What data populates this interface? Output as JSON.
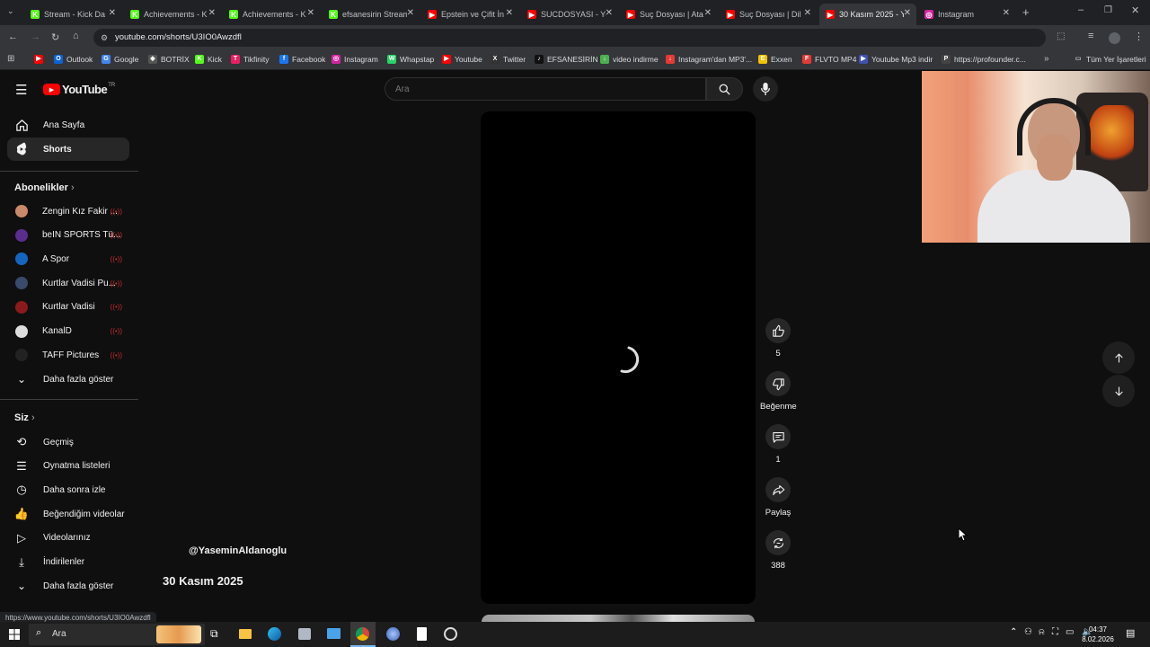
{
  "browser": {
    "tabs": [
      {
        "title": "Stream - Kick Da",
        "favicon": "K",
        "color": "#53fc18"
      },
      {
        "title": "Achievements - K",
        "favicon": "K",
        "color": "#53fc18"
      },
      {
        "title": "Achievements - K",
        "favicon": "K",
        "color": "#53fc18"
      },
      {
        "title": "efsanesirin Stream",
        "favicon": "K",
        "color": "#53fc18"
      },
      {
        "title": "Epstein ve Çifit İn",
        "favicon": "▶",
        "color": "#ff0000"
      },
      {
        "title": "SUCDOSYASI - Yo",
        "favicon": "▶",
        "color": "#ff0000"
      },
      {
        "title": "Suç Dosyası | Ata",
        "favicon": "▶",
        "color": "#ff0000"
      },
      {
        "title": "Suç Dosyası | Dil",
        "favicon": "▶",
        "color": "#ff0000"
      },
      {
        "title": "30 Kasım 2025 - Y",
        "favicon": "▶",
        "color": "#ff0000"
      },
      {
        "title": "Instagram",
        "favicon": "◎",
        "color": "#d6249f"
      }
    ],
    "url": "youtube.com/shorts/U3IO0Awzdfl",
    "bookmarks": [
      {
        "label": "",
        "icon": "▶",
        "color": "#ff0000"
      },
      {
        "label": "Outlook",
        "icon": "O",
        "color": "#0a64d6"
      },
      {
        "label": "Google",
        "icon": "G",
        "color": "#4285f4"
      },
      {
        "label": "BOTRİX",
        "icon": "◆",
        "color": "#555"
      },
      {
        "label": "Kick",
        "icon": "K",
        "color": "#53fc18"
      },
      {
        "label": "Tikfinity",
        "icon": "T",
        "color": "#e91e63"
      },
      {
        "label": "Facebook",
        "icon": "f",
        "color": "#1877f2"
      },
      {
        "label": "Instagram",
        "icon": "◎",
        "color": "#d6249f"
      },
      {
        "label": "Whapstap",
        "icon": "W",
        "color": "#25d366"
      },
      {
        "label": "Youtube",
        "icon": "▶",
        "color": "#ff0000"
      },
      {
        "label": "Twitter",
        "icon": "X",
        "color": "#333"
      },
      {
        "label": "EFSANESİRİN",
        "icon": "♪",
        "color": "#111"
      },
      {
        "label": "video indirme",
        "icon": "↓",
        "color": "#4caf50"
      },
      {
        "label": "Instagram'dan MP3'...",
        "icon": "↓",
        "color": "#e53935"
      },
      {
        "label": "Exxen",
        "icon": "E",
        "color": "#f4c300"
      },
      {
        "label": "FLVTO MP4",
        "icon": "F",
        "color": "#e53935"
      },
      {
        "label": "Youtube Mp3 indir",
        "icon": "▶",
        "color": "#3f51b5"
      },
      {
        "label": "https://profounder.c...",
        "icon": "P",
        "color": "#444"
      }
    ],
    "all_bookmarks": "Tüm Yer İşaretleri",
    "status_url": "https://www.youtube.com/shorts/U3IO0Awzdfl"
  },
  "youtube": {
    "logo": "YouTube",
    "region": "TR",
    "search_placeholder": "Ara",
    "nav": [
      {
        "label": "Ana Sayfa",
        "icon": "home-icon"
      },
      {
        "label": "Shorts",
        "icon": "shorts-icon"
      }
    ],
    "subs_header": "Abonelikler",
    "subs": [
      {
        "label": "Zengin Kız Fakir ...",
        "color": "#c98a6a"
      },
      {
        "label": "beIN SPORTS Tü...",
        "color": "#5b2d8e"
      },
      {
        "label": "A Spor",
        "color": "#1565c0"
      },
      {
        "label": "Kurtlar Vadisi Pu...",
        "color": "#3a4a6a"
      },
      {
        "label": "Kurtlar Vadisi",
        "color": "#8b1a1a"
      },
      {
        "label": "KanalD",
        "color": "#dddddd"
      },
      {
        "label": "TAFF Pictures",
        "color": "#222222"
      }
    ],
    "show_more_subs": "Daha fazla göster",
    "you_header": "Siz",
    "you": [
      {
        "label": "Geçmiş",
        "icon": "history-icon"
      },
      {
        "label": "Oynatma listeleri",
        "icon": "playlists-icon"
      },
      {
        "label": "Daha sonra izle",
        "icon": "watch-later-icon"
      },
      {
        "label": "Beğendiğim videolar",
        "icon": "liked-videos-icon"
      },
      {
        "label": "Videolarınız",
        "icon": "your-videos-icon"
      },
      {
        "label": "İndirilenler",
        "icon": "downloads-icon"
      }
    ],
    "show_more_you": "Daha fazla göster",
    "channel": "@YaseminAldanoglu",
    "video_title": "30 Kasım 2025",
    "actions": {
      "likes": "5",
      "dislike_label": "Beğenme",
      "comments": "1",
      "share_label": "Paylaş",
      "remix_count": "388"
    }
  },
  "taskbar": {
    "search": "Ara",
    "time": "04:37",
    "date": "8.02.2026"
  }
}
